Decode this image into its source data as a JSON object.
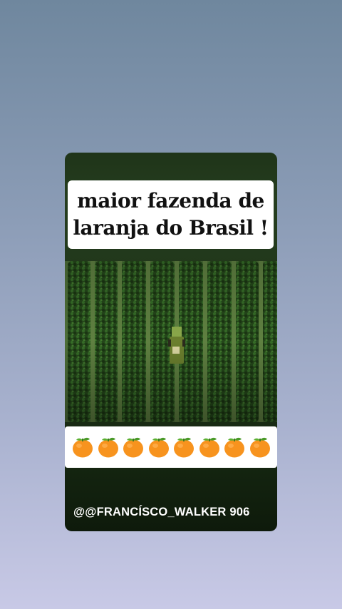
{
  "story": {
    "title_lines": [
      "maior fazenda de",
      "laranja do Brasil !"
    ],
    "emoji_row": {
      "icon": "tangerine-emoji",
      "count": 8
    },
    "watermark": "@@FRANCÍSCO_WALKER 906"
  },
  "colors": {
    "background_top": "#6f879e",
    "background_bottom": "#c8c9e6",
    "card_green": "#1f3419",
    "orange": "#f7931e",
    "leaf": "#5bb031"
  }
}
